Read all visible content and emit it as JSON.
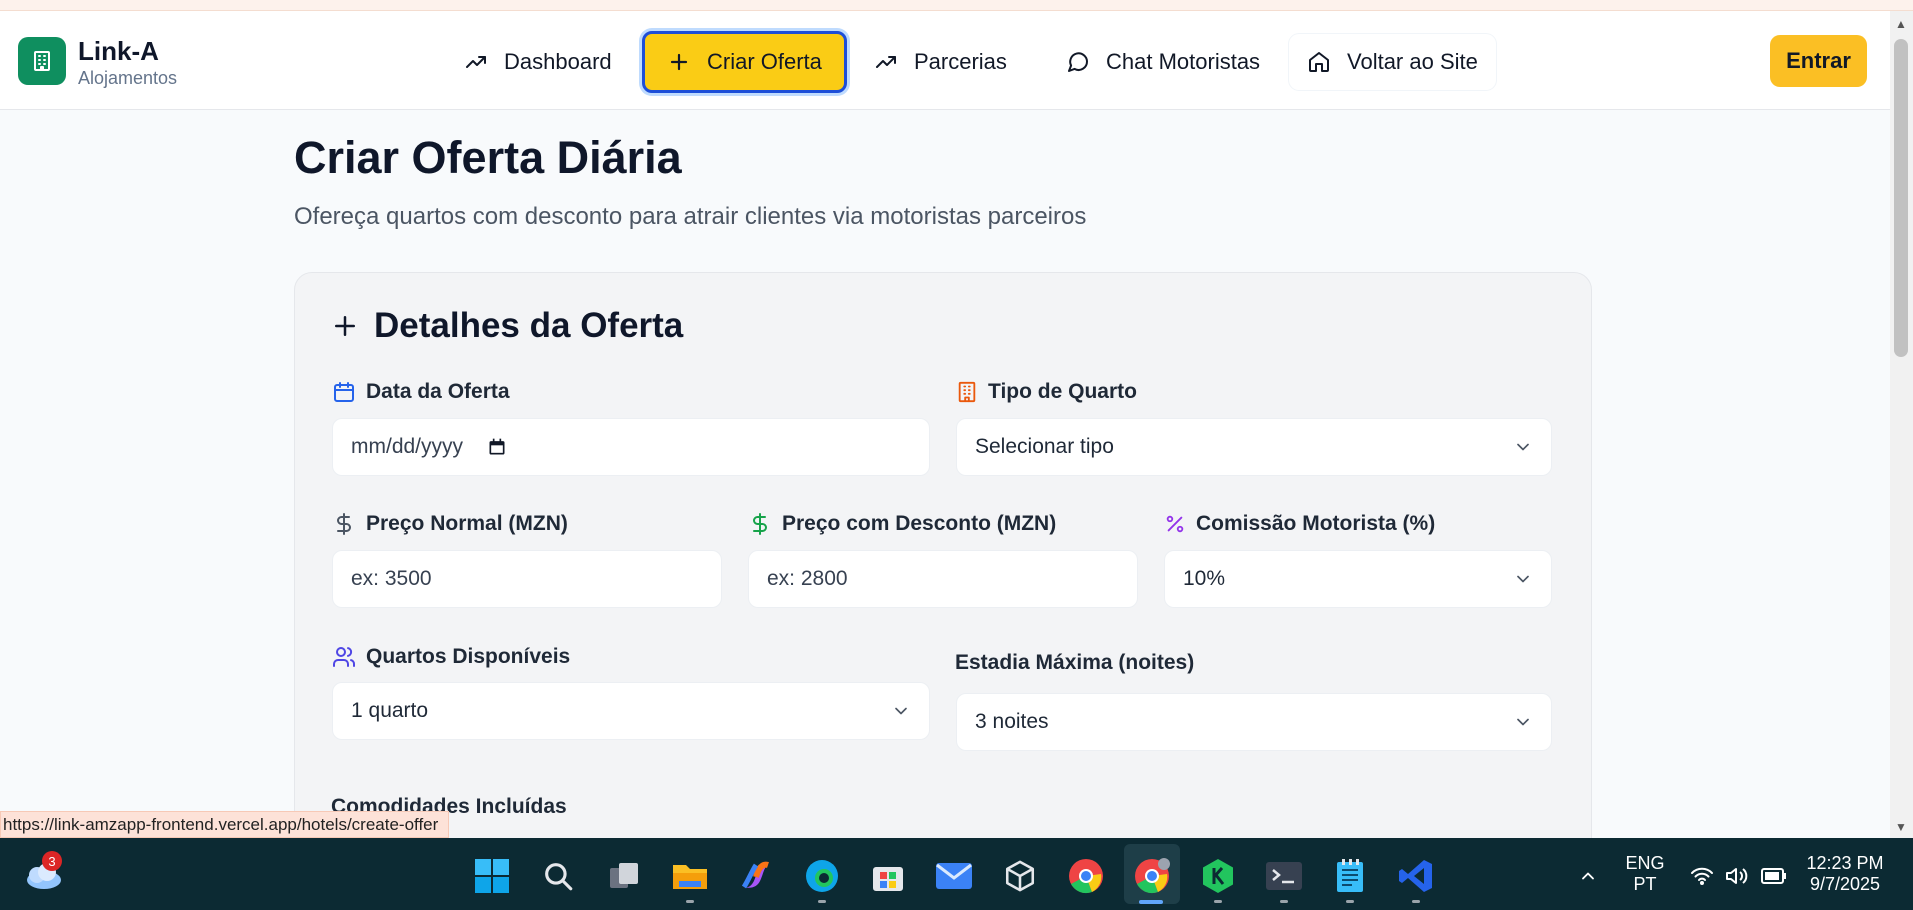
{
  "brand": {
    "title": "Link-A",
    "subtitle": "Alojamentos"
  },
  "nav": {
    "dashboard": "Dashboard",
    "create_offer": "Criar Oferta",
    "partnerships": "Parcerias",
    "driver_chat": "Chat Motoristas",
    "back_to_site": "Voltar ao Site",
    "login": "Entrar"
  },
  "page": {
    "title": "Criar Oferta Diária",
    "subtitle": "Ofereça quartos com desconto para atrair clientes via motoristas parceiros"
  },
  "form": {
    "section_title": "Detalhes da Oferta",
    "offer_date_label": "Data da Oferta",
    "offer_date_value": "mm/dd/yyyy",
    "room_type_label": "Tipo de Quarto",
    "room_type_value": "Selecionar tipo",
    "normal_price_label": "Preço Normal (MZN)",
    "normal_price_placeholder": "ex: 3500",
    "discount_price_label": "Preço com Desconto (MZN)",
    "discount_price_placeholder": "ex: 2800",
    "commission_label": "Comissão Motorista (%)",
    "commission_value": "10%",
    "rooms_available_label": "Quartos Disponíveis",
    "rooms_available_value": "1 quarto",
    "max_stay_label": "Estadia Máxima (noites)",
    "max_stay_value": "3 noites",
    "amenities_label": "Comodidades Incluídas"
  },
  "status_url": "https://link-amzapp-frontend.vercel.app/hotels/create-offer",
  "taskbar": {
    "weather_badge": "3",
    "lang_line1": "ENG",
    "lang_line2": "PT",
    "time": "12:23 PM",
    "date": "9/7/2025",
    "icons": [
      "weather-icon",
      "windows-start-icon",
      "search-icon",
      "task-view-icon",
      "file-explorer-icon",
      "copilot-icon",
      "edge-icon",
      "store-icon",
      "mail-icon",
      "cube-app-icon",
      "chrome-icon",
      "chrome-profile-icon",
      "k-app-icon",
      "terminal-icon",
      "notepad-icon",
      "vscode-icon"
    ]
  },
  "colors": {
    "accent_yellow": "#facc15",
    "brand_green": "#0f8f5f",
    "focus_blue": "#1d4ed8",
    "taskbar": "#0c2a33"
  }
}
